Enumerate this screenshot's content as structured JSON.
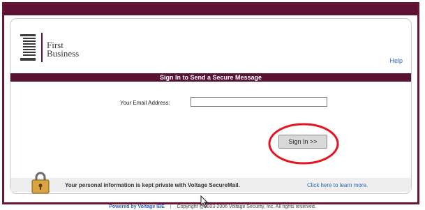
{
  "brand": {
    "line1": "First",
    "line2": "Business",
    "colors": {
      "maroon": "#5b1233",
      "link": "#2f66b8",
      "highlight": "#e5141e"
    }
  },
  "header": {
    "help_label": "Help"
  },
  "banner": {
    "title": "Sign In to Send a Secure Message"
  },
  "form": {
    "email_label": "Your Email Address:",
    "email_value": "",
    "signin_label": "Sign In >>"
  },
  "privacy": {
    "icon": "padlock-icon",
    "text": "Your personal information is kept private with Voltage SecureMail.",
    "link": "Click here to learn more."
  },
  "footer": {
    "powered": "Powered by Voltage IBE",
    "separator": "|",
    "copyright": "Copyright @2003-2006 Voltage Security, Inc. All rights reserved."
  }
}
